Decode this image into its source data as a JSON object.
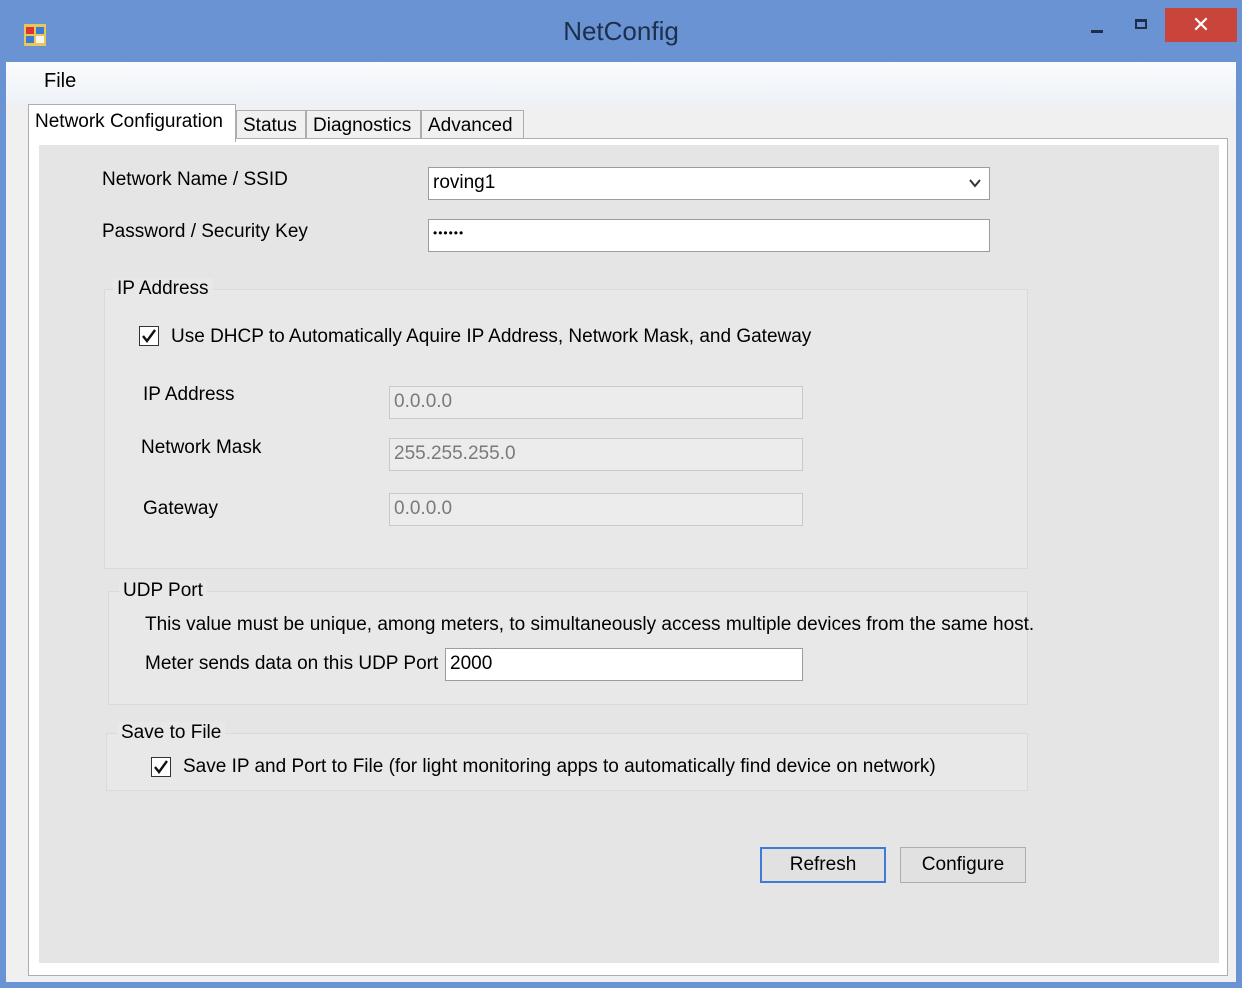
{
  "window": {
    "title": "NetConfig",
    "close_symbol": "✕"
  },
  "menu": {
    "file": "File"
  },
  "tabs": [
    {
      "label": "Network Configuration",
      "active": true
    },
    {
      "label": "Status",
      "active": false
    },
    {
      "label": "Diagnostics",
      "active": false
    },
    {
      "label": "Advanced",
      "active": false
    }
  ],
  "network": {
    "ssid_label": "Network Name / SSID",
    "ssid_value": "roving1",
    "password_label": "Password / Security Key",
    "password_value": "••••••"
  },
  "ip_group": {
    "title": "IP Address",
    "dhcp_label": "Use DHCP to Automatically Aquire IP Address, Network Mask, and Gateway",
    "dhcp_checked": true,
    "ip_label": "IP Address",
    "ip_value": "0.0.0.0",
    "mask_label": "Network Mask",
    "mask_value": "255.255.255.0",
    "gateway_label": "Gateway",
    "gateway_value": "0.0.0.0"
  },
  "udp_group": {
    "title": "UDP Port",
    "note": "This value must be unique, among meters, to simultaneously access multiple devices from the same host.",
    "port_label": "Meter sends data on this UDP Port",
    "port_value": "2000"
  },
  "save_group": {
    "title": "Save to File",
    "save_label": "Save IP and Port to File (for light monitoring apps to automatically find device on network)",
    "save_checked": true
  },
  "buttons": {
    "refresh": "Refresh",
    "configure": "Configure"
  },
  "colors": {
    "titlebar": "#6a93d4",
    "close_button": "#c9443a",
    "default_button_border": "#3d7bd9"
  },
  "icons": {
    "app": "app-icon",
    "dropdown": "chevron-down-icon",
    "check": "checkmark-icon"
  }
}
